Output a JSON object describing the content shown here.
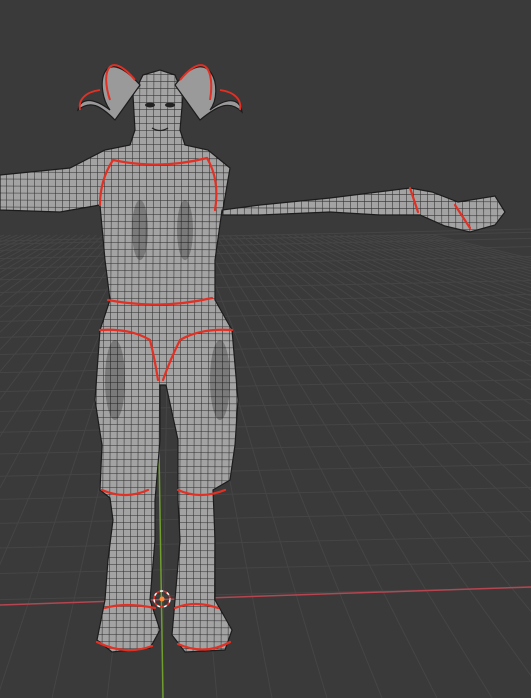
{
  "viewport": {
    "view": "perspective",
    "shading": "solid",
    "overlay": "wireframe",
    "background_color": "#3a3a3a",
    "grid_color": "#454545",
    "x_axis_color": "#b54550",
    "y_axis_color": "#6f9d2e",
    "mesh_color": "#a3a3a3",
    "wire_color": "#1c1c1c",
    "seam_color": "#e23024",
    "cursor_color": "#ff8e3a"
  },
  "model": {
    "type": "humanoid creature (ram horns, hoofed feet)",
    "pose": "T-pose",
    "visible_seams": [
      "horns",
      "neck",
      "shoulders",
      "wrist",
      "waist",
      "hips",
      "knees",
      "ankles",
      "hooves"
    ]
  },
  "icons": {
    "cursor": "3d-cursor-icon"
  }
}
